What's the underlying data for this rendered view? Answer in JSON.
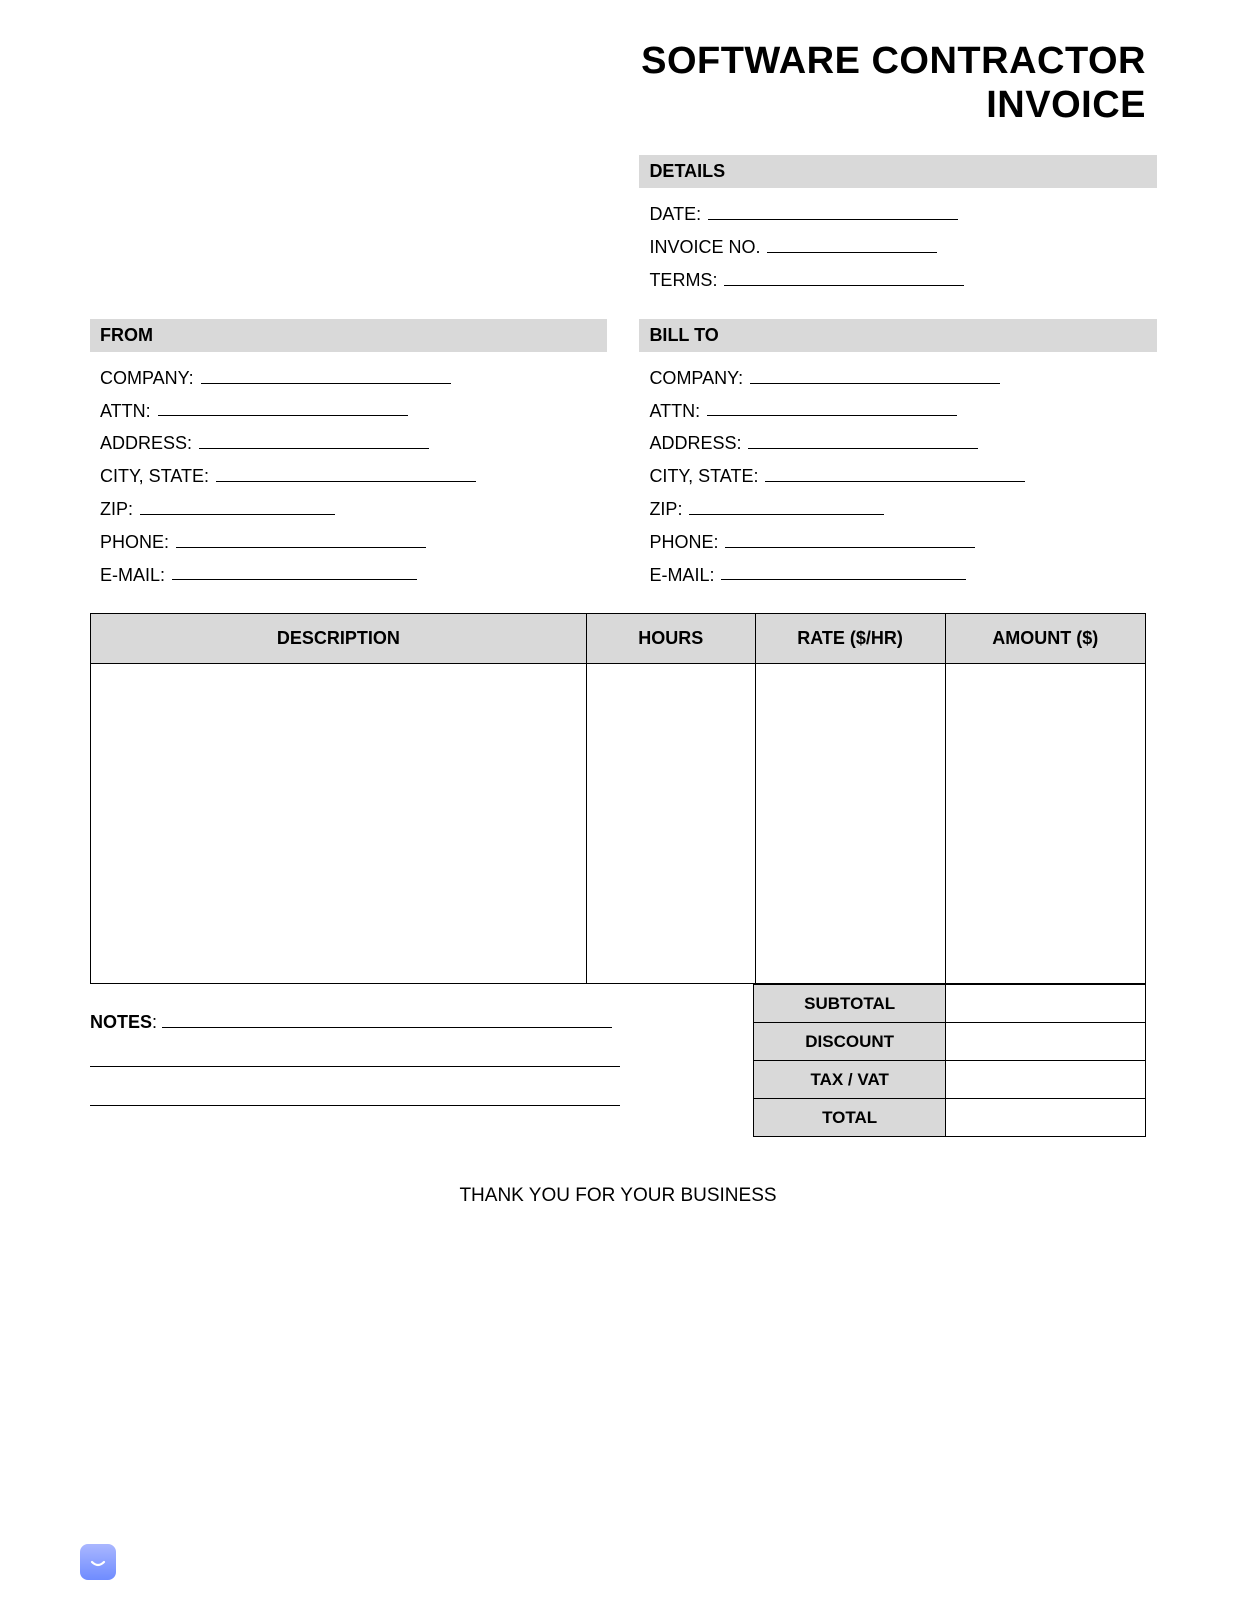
{
  "title_line1": "SOFTWARE CONTRACTOR",
  "title_line2": "INVOICE",
  "details": {
    "header": "DETAILS",
    "date_label": "DATE:",
    "invoice_no_label": "INVOICE NO.",
    "terms_label": "TERMS:"
  },
  "from": {
    "header": "FROM",
    "company_label": "COMPANY:",
    "attn_label": "ATTN:",
    "address_label": "ADDRESS:",
    "city_state_label": "CITY, STATE:",
    "zip_label": "ZIP:",
    "phone_label": "PHONE:",
    "email_label": "E-MAIL:"
  },
  "bill_to": {
    "header": "BILL TO",
    "company_label": "COMPANY:",
    "attn_label": "ATTN:",
    "address_label": "ADDRESS:",
    "city_state_label": "CITY, STATE:",
    "zip_label": "ZIP:",
    "phone_label": "PHONE:",
    "email_label": "E-MAIL:"
  },
  "table": {
    "col_description": "DESCRIPTION",
    "col_hours": "HOURS",
    "col_rate": "RATE ($/HR)",
    "col_amount": "AMOUNT ($)"
  },
  "notes_label": "NOTES",
  "notes_colon": ":",
  "totals": {
    "subtotal": "SUBTOTAL",
    "discount": "DISCOUNT",
    "tax_vat": "TAX / VAT",
    "total": "TOTAL"
  },
  "thank_you": "THANK YOU FOR YOUR BUSINESS"
}
